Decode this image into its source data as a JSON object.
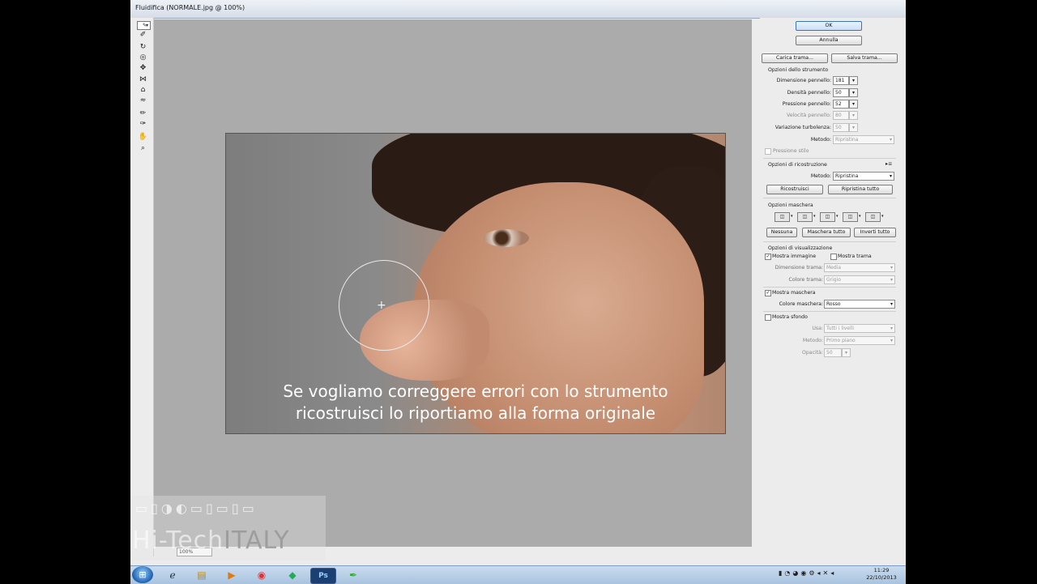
{
  "window": {
    "title": "Fluidifica (NORMALE.jpg @ 100%)"
  },
  "canvas": {
    "caption_line1": "Se vogliamo correggere errori con lo strumento",
    "caption_line2": "ricostruisci lo riportiamo alla forma originale",
    "zoom": "100%"
  },
  "panel": {
    "ok": "OK",
    "annulla": "Annulla",
    "carica_trama": "Carica trama...",
    "salva_trama": "Salva trama...",
    "opzioni_strumento": "Opzioni dello strumento",
    "dimensione_label": "Dimensione pennello:",
    "dimensione_value": "181",
    "densita_label": "Densità pennello:",
    "densita_value": "50",
    "pressione_label": "Pressione pennello:",
    "pressione_value": "52",
    "velocita_label": "Velocità pennello:",
    "velocita_value": "80",
    "turbolenza_label": "Variazione turbolenza:",
    "turbolenza_value": "50",
    "metodo_label": "Metodo:",
    "metodo_value": "Ripristina",
    "pressione_stilo": "Pressione stilo",
    "opzioni_ricostruzione": "Opzioni di ricostruzione",
    "metodo2_label": "Metodo:",
    "metodo2_value": "Ripristina",
    "ricostruisci": "Ricostruisci",
    "ripristina_tutto": "Ripristina tutto",
    "opzioni_maschera": "Opzioni maschera",
    "nessuna": "Nessuna",
    "maschera_tutto": "Maschera tutto",
    "inverti_tutto": "Inverti tutto",
    "opzioni_visualizzazione": "Opzioni di visualizzazione",
    "mostra_immagine": "Mostra immagine",
    "mostra_trama": "Mostra trama",
    "dimensione_trama_label": "Dimensione trama:",
    "dimensione_trama_value": "Media",
    "colore_trama_label": "Colore trama:",
    "colore_trama_value": "Grigio",
    "mostra_maschera": "Mostra maschera",
    "colore_maschera_label": "Colore maschera:",
    "colore_maschera_value": "Rosso",
    "mostra_sfondo": "Mostra sfondo",
    "usa_label": "Usa:",
    "usa_value": "Tutti i livelli",
    "metodo3_label": "Metodo:",
    "metodo3_value": "Primo piano",
    "opacita_label": "Opacità:",
    "opacita_value": "50"
  },
  "watermark": {
    "text_a": "Hi-Tech",
    "text_b": "ITALY"
  },
  "taskbar": {
    "time": "11:29",
    "date": "22/10/2013",
    "ps_label": "Ps"
  }
}
